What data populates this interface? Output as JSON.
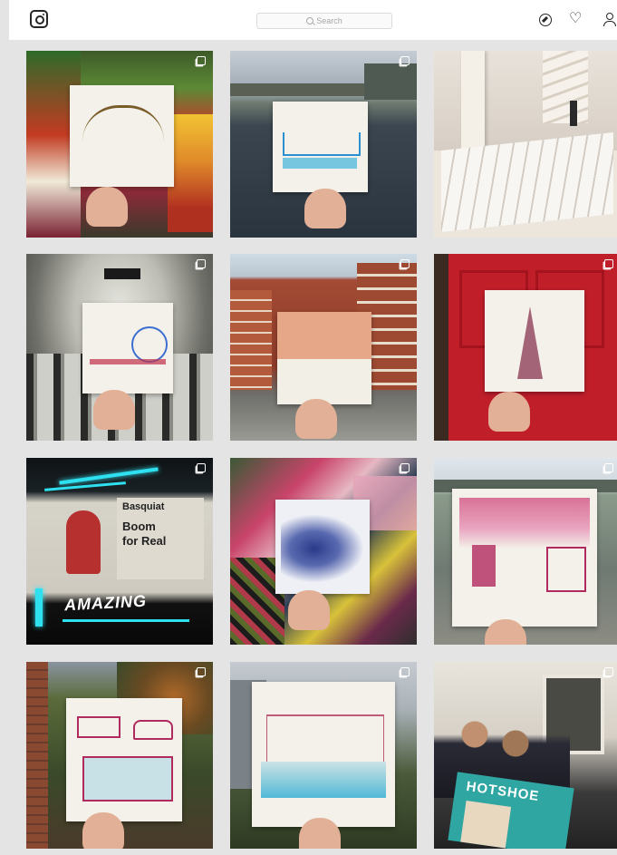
{
  "header": {
    "logo_icon": "instagram-logo-icon",
    "search": {
      "placeholder": "Search",
      "icon": "search-icon"
    },
    "icons": [
      "compass-icon",
      "heart-icon",
      "user-icon"
    ]
  },
  "grid": {
    "posts": [
      {
        "subject": "sketch held in front of vegetable market stall",
        "multiple": true
      },
      {
        "subject": "sketch held over river Thames with Tower Bridge",
        "multiple": true
      },
      {
        "subject": "paper sculpture of a building interior",
        "multiple": false
      },
      {
        "subject": "sketch held in underground escalator tunnel",
        "multiple": true
      },
      {
        "subject": "sketch held on a red brick street",
        "multiple": true
      },
      {
        "subject": "sketch of the Shard held against a red door",
        "multiple": true
      },
      {
        "subject": "Basquiat exhibition poster in the underground",
        "multiple": true
      },
      {
        "subject": "sketch held in front of graffiti wall",
        "multiple": true
      },
      {
        "subject": "pink sketch held over square with statue",
        "multiple": true
      },
      {
        "subject": "pink sketch held in front of tree",
        "multiple": true
      },
      {
        "subject": "blue sketch held in front of city skyline",
        "multiple": true
      },
      {
        "subject": "crowd at a gallery with Hotshoe magazine",
        "multiple": true
      }
    ],
    "poster": {
      "title_line1": "Basquiat",
      "title_line2": "Boom",
      "title_line3": "for Real",
      "graffiti": "AMAZING"
    },
    "magazine": {
      "title": "HOTSHOE"
    }
  }
}
